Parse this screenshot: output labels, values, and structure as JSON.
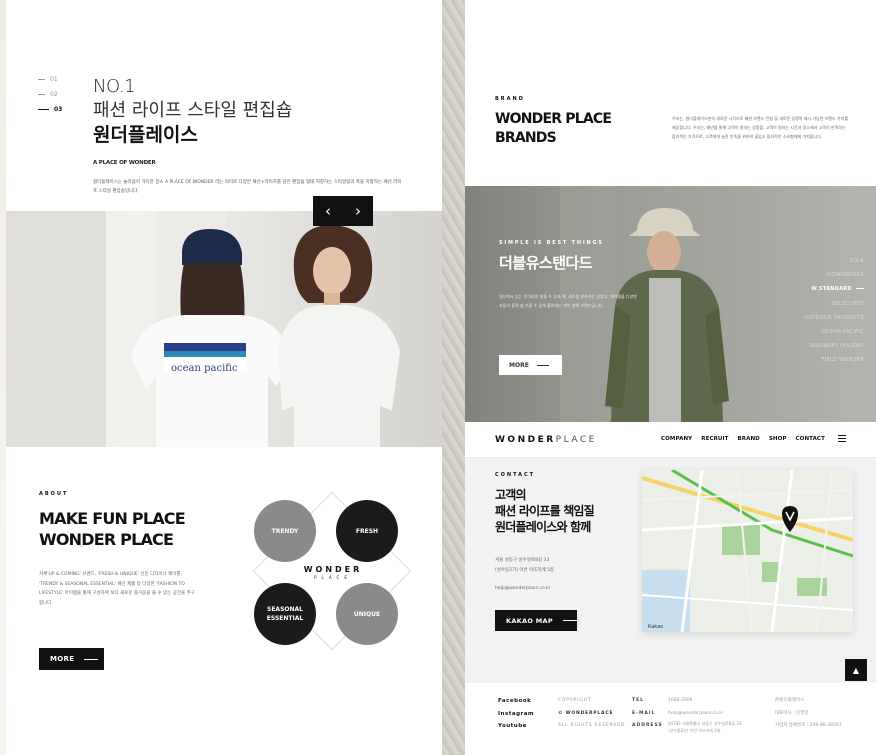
{
  "left": {
    "nav_numbers": [
      "01",
      "02",
      "03"
    ],
    "active_index": 2,
    "title_line1": "NO.1",
    "title_line2": "패션 라이프 스타일 편집숍",
    "title_line3": "원더플레이스",
    "subheading": "A PLACE OF WONDER",
    "description": "원더플레이스는 놀라움이 가득한 장소 A PLACE OF WONDER 라는 의미로 다양한 패션+라이프를 담은 편집숍 형태 지향하는 스타일링과 폭을 지향하는 패션 라이프 스타일 편집숍입니다.",
    "slider_prev": "‹",
    "slider_next": "›",
    "shirt_text": "ocean pacific",
    "about_label": "ABOUT",
    "about_title_1": "MAKE FUN PLACE",
    "about_title_2": "WONDER PLACE",
    "about_text": "자체'UP & COMING' 브랜드, 'FRESH & UNIQUE' 신진 디자이너 제이를, 'TRENDY & SEASONAL ESSENTIAL' 패션 제품 등 다양한 'FASHION TO LIFESTYLE' 아이템을 통해 구성하여 보다 새로운 즐거움을 줄 수 있는 공간을 추구 합니다.",
    "more_button": "MORE",
    "circles": {
      "trendy": "TRENDY",
      "fresh": "FRESH",
      "seasonal": "SEASONAL ESSENTIAL",
      "unique": "UNIQUE"
    },
    "logo_main": "WONDER",
    "logo_sub": "PLACE"
  },
  "right": {
    "brand_label": "BRAND",
    "brand_title_1": "WONDER PLACE",
    "brand_title_2": "BRANDS",
    "brand_description": "우리는, 원더플레이스만의 새로운 시각으로 패션 브랜드 런칭 및 새로운 경쟁력 제시 가능한 브랜드 가치를 제공합니다. 우리는, 매년을 통해 고객이 원하는 상품을, 고객이 원하는 시간과 장소에서 고객이 만족하는 합리적인 가격으로, 고객에게 늘린 만족을 위하여 끊임고 합리적인 소비형태에 가져옵니다.",
    "hero_small": "SIMPLE IS BEST THINGS",
    "hero_title": "더블유스탠다드",
    "hero_desc": "일상에서 입는 옷이라면 핏을 수 있게 해, 새로움 펀하라는 있었다. 대이템을 다양한 자들의 용적 쉽 기울 수 있게 풀어내는 에어 방해 브랜드입니다.",
    "hero_more": "MORE",
    "brand_list": [
      "SOLA",
      "ISOWONDERS",
      "W.STANDARD",
      "SELECCIOIT",
      "OUTDOOR PRODUCTS",
      "OCEAN PACIFIC",
      "ORDINARY HOLIDAY",
      "FIELD WONDER"
    ],
    "brand_active": "W.STANDARD",
    "logo_bold": "WONDER",
    "logo_light": "PLACE",
    "nav": [
      "COMPANY",
      "RECRUIT",
      "BRAND",
      "SHOP",
      "CONTACT"
    ],
    "contact_label": "CONTACT",
    "contact_title_1": "고객의",
    "contact_title_2": "패션 라이프를 책임질",
    "contact_title_3": "원더플레이스와 함께",
    "address_1": "서울 성동구 성수일로8길 33",
    "address_2": "(성수동2가) 어반 아뜨리에 5층",
    "email": "help@wonderplace.co.kr",
    "kakao_button": "KAKAO MAP",
    "map_attribution": "Kakao",
    "top_button": "▲",
    "footer": {
      "sns": [
        "Facebook",
        "Instagram",
        "Youtube"
      ],
      "copy_label": "COPYRIGHT",
      "copy_brand": "© WONDERPLACE",
      "copy_rights": "ALL RIGHTS RESERVED.",
      "tel_label": "TEL",
      "email_label": "E-MAIL",
      "address_label": "ADDRESS",
      "tel": "1688-2606",
      "email": "help@wonderplace.co.kr",
      "address": "04782 서울특별시 성동구 성수일로8길 33 (성수동2가) 어반 아뜨리에 5층",
      "company": "㈜원더플레이스",
      "ceo": "대표이사 : 김영민",
      "bizno": "사업자 등록번호 : 206-86-38567"
    }
  },
  "colors": {
    "black": "#111111",
    "gray_circle": "#8a8a8a",
    "hero_bg": "#9a9c95"
  }
}
